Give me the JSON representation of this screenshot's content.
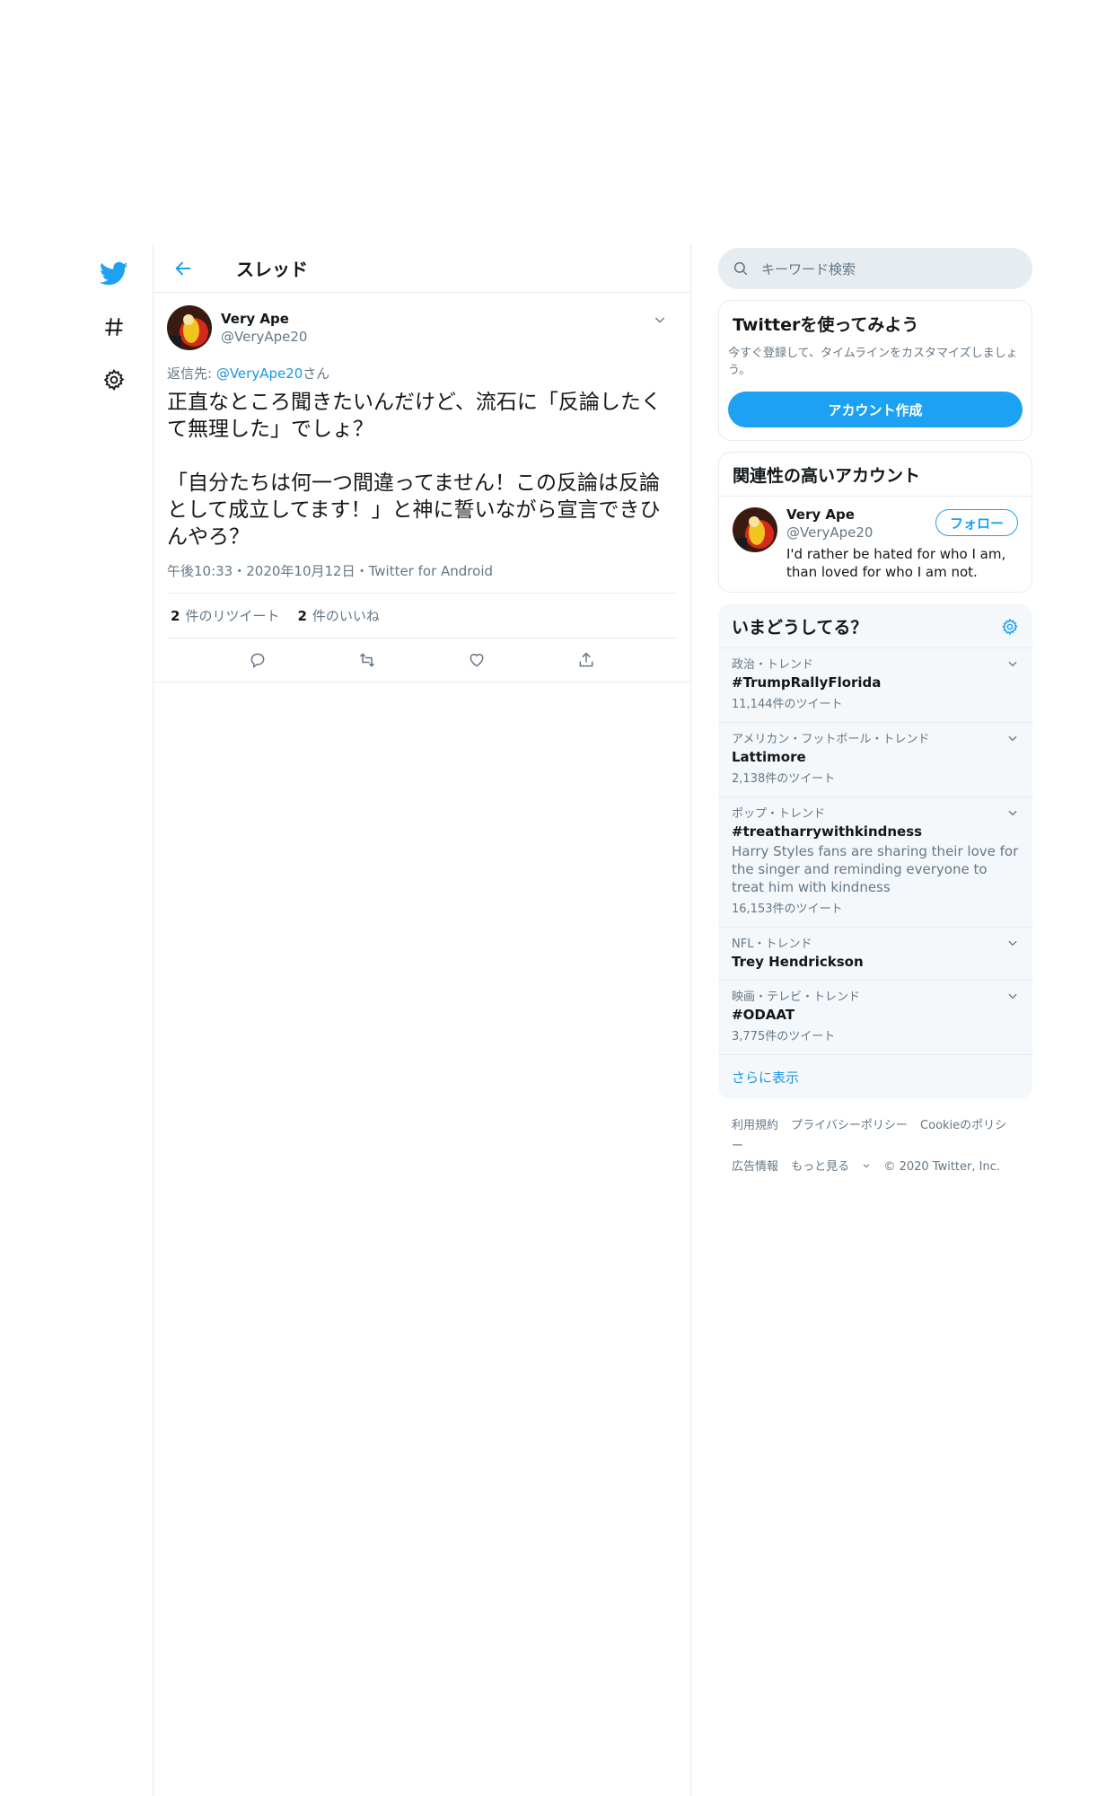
{
  "nav": {
    "icons": [
      "twitter-bird-icon",
      "hashtag-icon",
      "gear-icon"
    ]
  },
  "header": {
    "title": "スレッド"
  },
  "tweet": {
    "author_name": "Very Ape",
    "author_handle": "@VeryApe20",
    "reply_prefix": "返信先: ",
    "reply_handle": "@VeryApe20",
    "reply_suffix": "さん",
    "text": "正直なところ聞きたいんだけど、流石に「反論したくて無理した」でしょ？\n\n「自分たちは何一つ間違ってません！この反論は反論として成立してます！」と神に誓いながら宣言できひんやろ？",
    "meta": "午後10:33・2020年10月12日・Twitter for Android",
    "retweets_count": "2",
    "retweets_label": "件のリツイート",
    "likes_count": "2",
    "likes_label": "件のいいね"
  },
  "sidebar": {
    "search_placeholder": "キーワード検索",
    "signup": {
      "title": "Twitterを使ってみよう",
      "desc": "今すぐ登録して、タイムラインをカスタマイズしましょう。",
      "button": "アカウント作成"
    },
    "related": {
      "title": "関連性の高いアカウント",
      "name": "Very Ape",
      "handle": "@VeryApe20",
      "bio": "I'd rather be hated for who I am, than loved for who I am not.",
      "follow": "フォロー"
    },
    "trends": {
      "title": "いまどうしてる？",
      "items": [
        {
          "context": "政治・トレンド",
          "name": "#TrumpRallyFlorida",
          "desc": "",
          "count": "11,144件のツイート"
        },
        {
          "context": "アメリカン・フットボール・トレンド",
          "name": "Lattimore",
          "desc": "",
          "count": "2,138件のツイート"
        },
        {
          "context": "ポップ・トレンド",
          "name": "#treatharrywithkindness",
          "desc": "Harry Styles fans are sharing their love for the singer and reminding everyone to treat him with kindness",
          "count": "16,153件のツイート"
        },
        {
          "context": "NFL・トレンド",
          "name": "Trey Hendrickson",
          "desc": "",
          "count": ""
        },
        {
          "context": "映画・テレビ・トレンド",
          "name": "#ODAAT",
          "desc": "",
          "count": "3,775件のツイート"
        }
      ],
      "show_more": "さらに表示"
    },
    "footer": {
      "terms": "利用規約",
      "privacy": "プライバシーポリシー",
      "cookie": "Cookieのポリシー",
      "ads": "広告情報",
      "more": "もっと見る",
      "copyright": "© 2020 Twitter, Inc."
    }
  },
  "colors": {
    "accent": "#1da1f2",
    "link": "#1b95e0",
    "secondary_text": "#657786",
    "border": "#e6ecf0",
    "panel_bg": "#f5f8fa"
  }
}
